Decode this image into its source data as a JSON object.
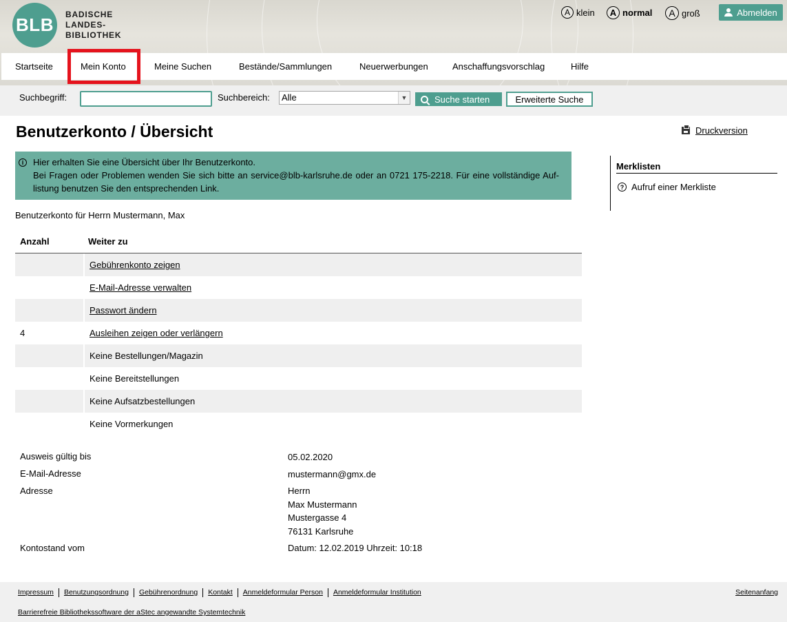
{
  "header": {
    "logo_abbr": "BLB",
    "logo_lines": [
      "BADISCHE",
      "LANDES-",
      "BIBLIOTHEK"
    ],
    "font_sizes": [
      {
        "glyph": "A",
        "label": "klein"
      },
      {
        "glyph": "A",
        "label": "normal"
      },
      {
        "glyph": "A",
        "label": "groß"
      }
    ],
    "logout_label": "Abmelden",
    "logout_icon": "user-icon"
  },
  "nav": {
    "items": [
      "Startseite",
      "Mein Konto",
      "Meine Suchen",
      "Bestände/Sammlungen",
      "Neuerwerbungen",
      "Anschaffungsvorschlag",
      "Hilfe"
    ],
    "active": "Mein Konto"
  },
  "search": {
    "term_label": "Suchbegriff:",
    "term_value": "",
    "scope_label": "Suchbereich:",
    "scope_value": "Alle",
    "submit_label": "Suche starten",
    "advanced_label": "Erweiterte Suche"
  },
  "main": {
    "title": "Benutzerkonto / Übersicht",
    "print_label": "Druckversion",
    "info_line1": "Hier erhalten Sie eine Übersicht über Ihr Benutzerkonto.",
    "info_line2": "Bei Fragen oder Problemen wenden Sie sich bitte an service@blb-karlsruhe.de oder an 0721 175-2218. Für eine vollständige Auf-listung benutzen Sie den entsprechenden Link.",
    "owner": "Benutzerkonto für Herrn Mustermann, Max",
    "table": {
      "headers": [
        "Anzahl",
        "Weiter zu"
      ],
      "rows": [
        {
          "count": "",
          "label": "Gebührenkonto zeigen",
          "link": true
        },
        {
          "count": "",
          "label": "E-Mail-Adresse verwalten",
          "link": true
        },
        {
          "count": "",
          "label": "Passwort ändern",
          "link": true
        },
        {
          "count": "4",
          "label": "Ausleihen zeigen oder verlängern",
          "link": true
        },
        {
          "count": "",
          "label": "Keine Bestellungen/Magazin",
          "link": false
        },
        {
          "count": "",
          "label": "Keine Bereitstellungen",
          "link": false
        },
        {
          "count": "",
          "label": "Keine Aufsatzbestellungen",
          "link": false
        },
        {
          "count": "",
          "label": "Keine Vormerkungen",
          "link": false
        }
      ]
    },
    "details": {
      "card_label": "Ausweis gültig bis",
      "card_value": "05.02.2020",
      "email_label": "E-Mail-Adresse",
      "email_value": "mustermann@gmx.de",
      "address_label": "Adresse",
      "address_lines": [
        "Herrn",
        "Max Mustermann",
        "Mustergasse 4",
        "76131 Karlsruhe"
      ],
      "balance_label": "Kontostand vom",
      "balance_value": "Datum: 12.02.2019 Uhrzeit: 10:18"
    }
  },
  "sidebar": {
    "title": "Merklisten",
    "link": "Aufruf einer Merkliste"
  },
  "footer": {
    "links": [
      "Impressum",
      "Benutzungsordnung",
      "Gebührenordnung",
      "Kontakt",
      "Anmeldeformular Person",
      "Anmeldeformular Institution"
    ],
    "top_link": "Seitenanfang",
    "credit": "Barrierefreie Bibliothekssoftware der aStec angewandte Systemtechnik"
  },
  "colors": {
    "brand": "#4e9e8f",
    "info_bg": "#6cae9f",
    "highlight": "#e5131d"
  }
}
